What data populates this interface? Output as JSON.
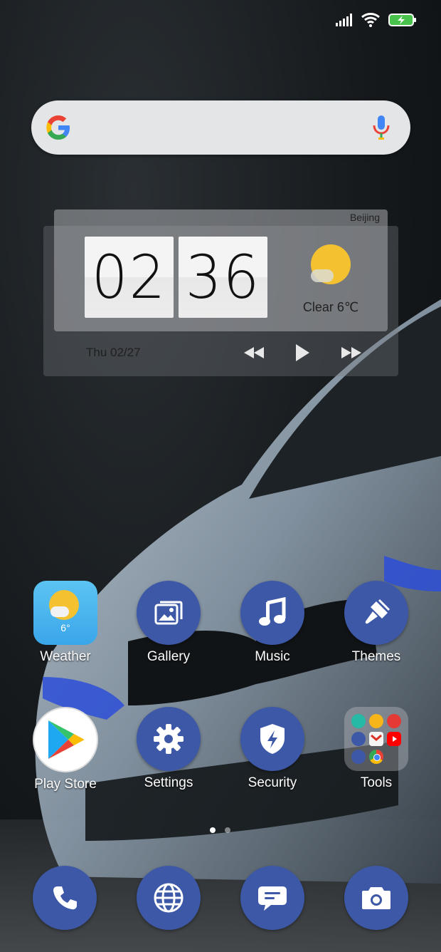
{
  "status_bar": {
    "icons": [
      "signal-icon",
      "wifi-icon",
      "battery-charging-icon"
    ]
  },
  "search": {
    "logo": "google-logo",
    "mic_icon": "mic-icon"
  },
  "clock_widget": {
    "city": "Beijing",
    "hours": "02",
    "minutes": "36",
    "weather": "Clear  6℃",
    "date": "Thu 02/27",
    "media_controls": [
      "rewind-icon",
      "play-icon",
      "fast-forward-icon"
    ]
  },
  "apps": {
    "row1": [
      {
        "label": "Weather",
        "icon": "weather-app-icon",
        "temp": "6°"
      },
      {
        "label": "Gallery",
        "icon": "gallery-icon"
      },
      {
        "label": "Music",
        "icon": "music-icon"
      },
      {
        "label": "Themes",
        "icon": "paintbrush-icon"
      }
    ],
    "row2": [
      {
        "label": "Play Store",
        "icon": "play-store-icon"
      },
      {
        "label": "Settings",
        "icon": "gear-icon"
      },
      {
        "label": "Security",
        "icon": "shield-icon"
      },
      {
        "label": "Tools",
        "icon": "folder-icon"
      }
    ]
  },
  "dock": [
    "phone-icon",
    "browser-icon",
    "messages-icon",
    "camera-icon"
  ],
  "page_indicator": {
    "pages": 2,
    "current": 1
  },
  "colors": {
    "icon_bg": "#3e58a8",
    "sun": "#f4c230",
    "battery": "#49c24b"
  }
}
